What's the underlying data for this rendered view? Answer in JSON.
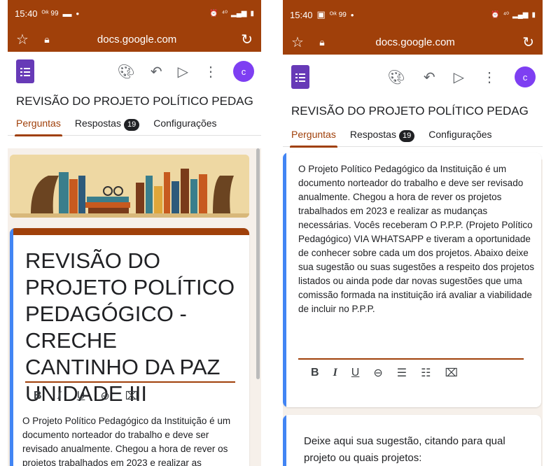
{
  "left_screen": {
    "status": {
      "time": "15:40",
      "carrier": "ᴼᶦᵏ 99",
      "signal": "⁴⁰"
    },
    "browser": {
      "url": "docs.google.com"
    },
    "doc_title": "REVISÃO DO PROJETO POLÍTICO PEDAG",
    "tabs": {
      "questions": "Perguntas",
      "responses": "Respostas",
      "responses_count": "19",
      "settings": "Configurações"
    },
    "form_title": "REVISÃO DO PROJETO POLÍTICO PEDAGÓGICO - CRECHE CANTINHO DA PAZ UNIDADE III",
    "description_visible": "O Projeto Político Pedagógico da Instituição é um documento norteador do trabalho e deve ser revisado anualmente. Chegou a hora de rever os projetos trabalhados em 2023 e realizar as"
  },
  "right_screen": {
    "status": {
      "time": "15:40",
      "carrier": "ᴼᶦᵏ 99",
      "signal": "⁴⁰"
    },
    "browser": {
      "url": "docs.google.com"
    },
    "doc_title": "REVISÃO DO PROJETO POLÍTICO PEDAG",
    "tabs": {
      "questions": "Perguntas",
      "responses": "Respostas",
      "responses_count": "19",
      "settings": "Configurações"
    },
    "description": "O Projeto Político Pedagógico da Instituição é um documento norteador do trabalho e deve ser revisado anualmente. Chegou a hora de rever os projetos trabalhados em 2023 e realizar as mudanças necessárias. Vocês receberam O P.P.P. (Projeto Político Pedagógico) VIA WHATSAPP e tiveram a oportunidade de conhecer sobre cada um dos projetos. Abaixo deixe sua sugestão ou suas sugestões a respeito dos projetos listados ou ainda pode dar novas sugestões que uma comissão formada na instituição irá avaliar a viabilidade de incluir no P.P.P.",
    "question_text": "Deixe aqui sua sugestão, citando para qual  projeto ou quais projetos:"
  },
  "formatting": {
    "bold": "B",
    "italic": "I",
    "underline": "U"
  },
  "colors": {
    "brand": "#a0400a",
    "accent_left": "#4285f4",
    "forms_purple": "#673ab7",
    "avatar": "#7e3ff2",
    "background": "#f6f0ea"
  },
  "avatar_letter": "c",
  "icons": [
    "star-icon",
    "lock-icon",
    "reload-icon",
    "palette-icon",
    "undo-icon",
    "send-icon",
    "more-vert-icon",
    "link-icon",
    "numbered-list-icon",
    "bulleted-list-icon",
    "clear-format-icon"
  ]
}
